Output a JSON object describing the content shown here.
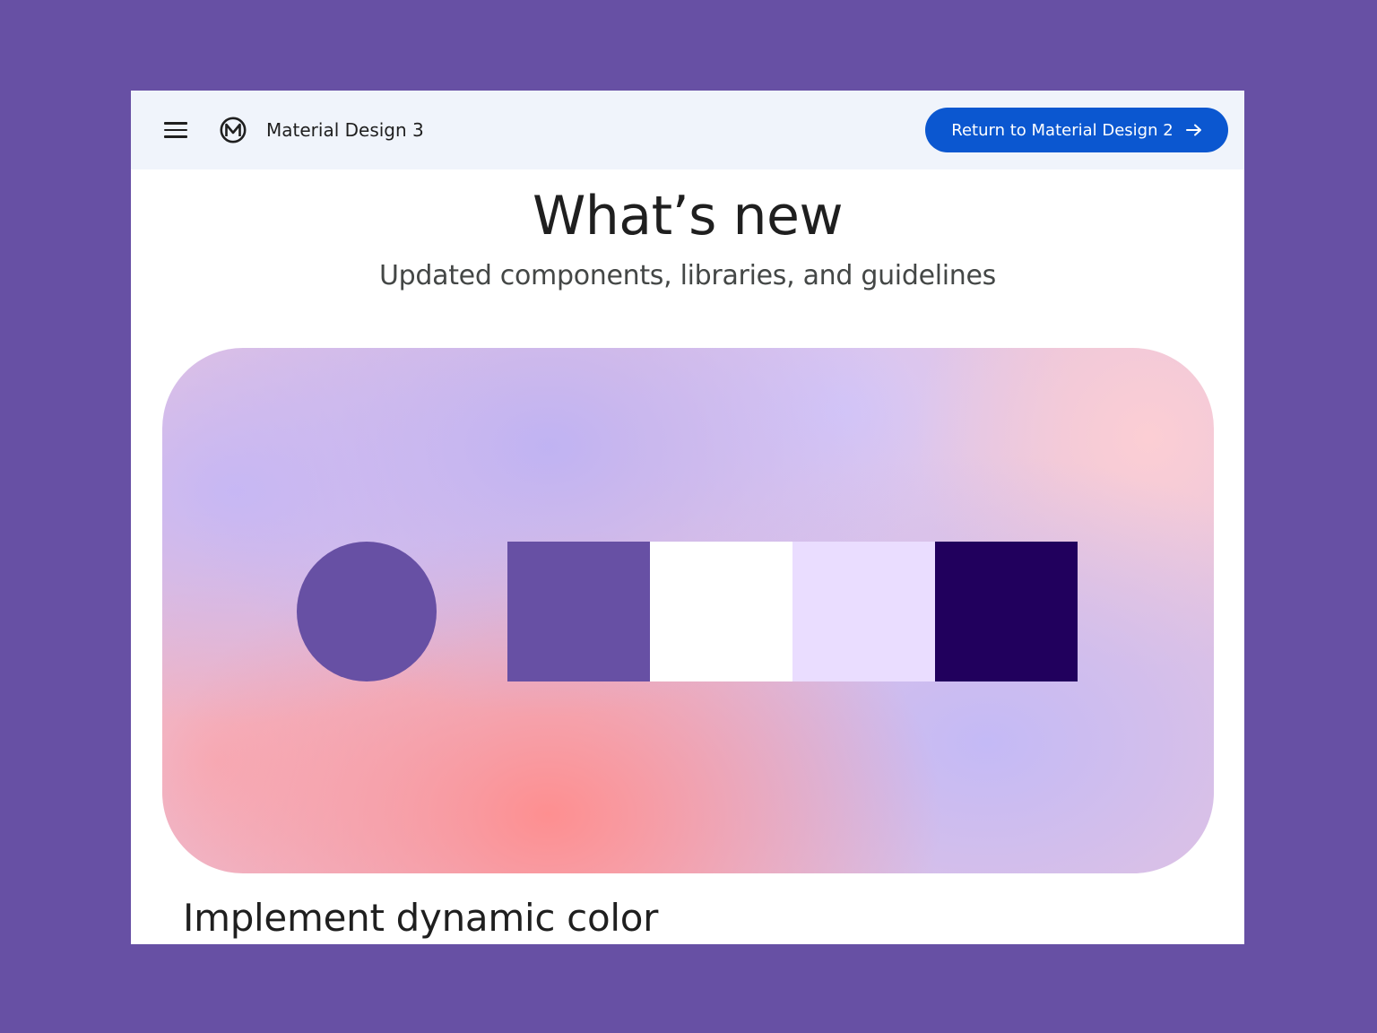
{
  "header": {
    "brand": "Material Design 3",
    "return_button_label": "Return to Material Design 2",
    "icons": {
      "menu": "hamburger-menu-icon",
      "logo": "material-logo-icon",
      "arrow": "arrow-right-icon"
    }
  },
  "main": {
    "title": "What’s new",
    "subtitle": "Updated components, libraries, and guidelines",
    "section_title": "Implement dynamic color"
  },
  "colors": {
    "page_background": "#6750a4",
    "topbar_background": "#f0f4fb",
    "button_primary": "#0b57d0",
    "shape_primary": "#6750a4",
    "swatches": [
      "#6750a4",
      "#ffffff",
      "#eaddff",
      "#21005d"
    ]
  }
}
